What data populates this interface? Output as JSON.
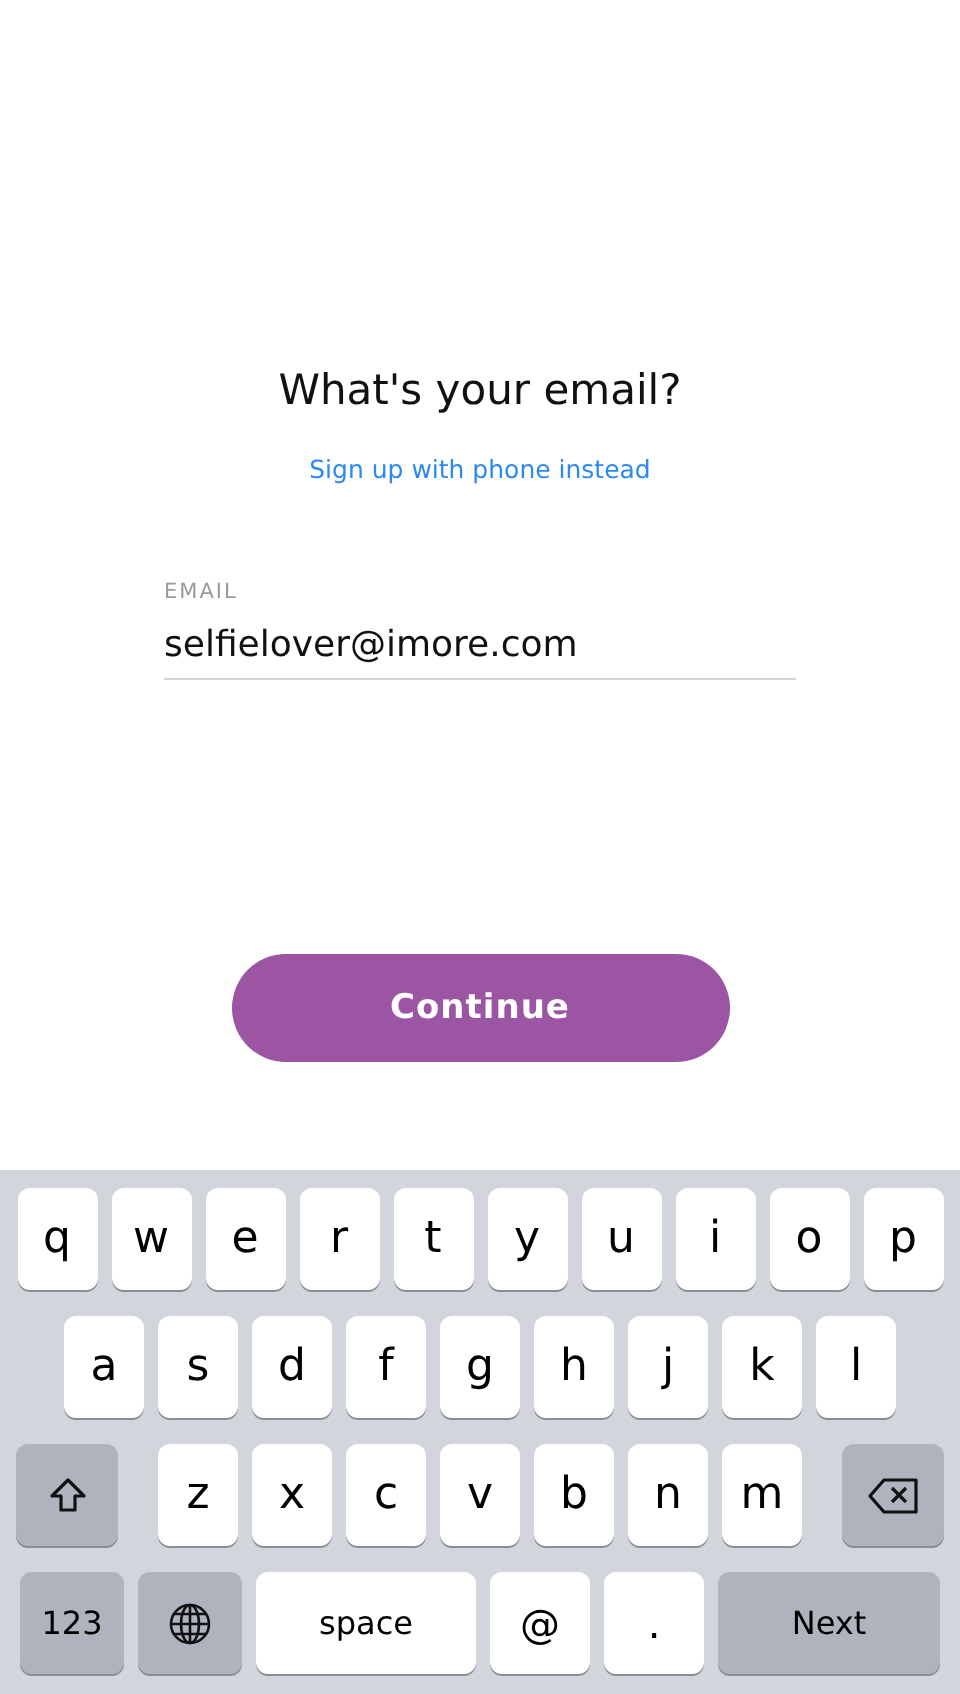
{
  "heading": "What's your email?",
  "alt_link": "Sign up with phone instead",
  "email_field": {
    "label": "EMAIL",
    "value": "selfielover@imore.com"
  },
  "continue_button": "Continue",
  "keyboard": {
    "rows": [
      {
        "keys": [
          {
            "kind": "letter",
            "label": "q"
          },
          {
            "kind": "letter",
            "label": "w"
          },
          {
            "kind": "letter",
            "label": "e"
          },
          {
            "kind": "letter",
            "label": "r"
          },
          {
            "kind": "letter",
            "label": "t"
          },
          {
            "kind": "letter",
            "label": "y"
          },
          {
            "kind": "letter",
            "label": "u"
          },
          {
            "kind": "letter",
            "label": "i"
          },
          {
            "kind": "letter",
            "label": "o"
          },
          {
            "kind": "letter",
            "label": "p"
          }
        ]
      },
      {
        "keys": [
          {
            "kind": "letter",
            "label": "a"
          },
          {
            "kind": "letter",
            "label": "s"
          },
          {
            "kind": "letter",
            "label": "d"
          },
          {
            "kind": "letter",
            "label": "f"
          },
          {
            "kind": "letter",
            "label": "g"
          },
          {
            "kind": "letter",
            "label": "h"
          },
          {
            "kind": "letter",
            "label": "j"
          },
          {
            "kind": "letter",
            "label": "k"
          },
          {
            "kind": "letter",
            "label": "l"
          }
        ]
      },
      {
        "keys": [
          {
            "kind": "shift"
          },
          {
            "kind": "letter",
            "label": "z"
          },
          {
            "kind": "letter",
            "label": "x"
          },
          {
            "kind": "letter",
            "label": "c"
          },
          {
            "kind": "letter",
            "label": "v"
          },
          {
            "kind": "letter",
            "label": "b"
          },
          {
            "kind": "letter",
            "label": "n"
          },
          {
            "kind": "letter",
            "label": "m"
          },
          {
            "kind": "delete"
          }
        ]
      },
      {
        "keys": [
          {
            "kind": "numbers",
            "label": "123"
          },
          {
            "kind": "globe"
          },
          {
            "kind": "space",
            "label": "space"
          },
          {
            "kind": "symbol",
            "label": "@"
          },
          {
            "kind": "symbol",
            "label": "."
          },
          {
            "kind": "return",
            "label": "Next"
          }
        ]
      }
    ]
  }
}
